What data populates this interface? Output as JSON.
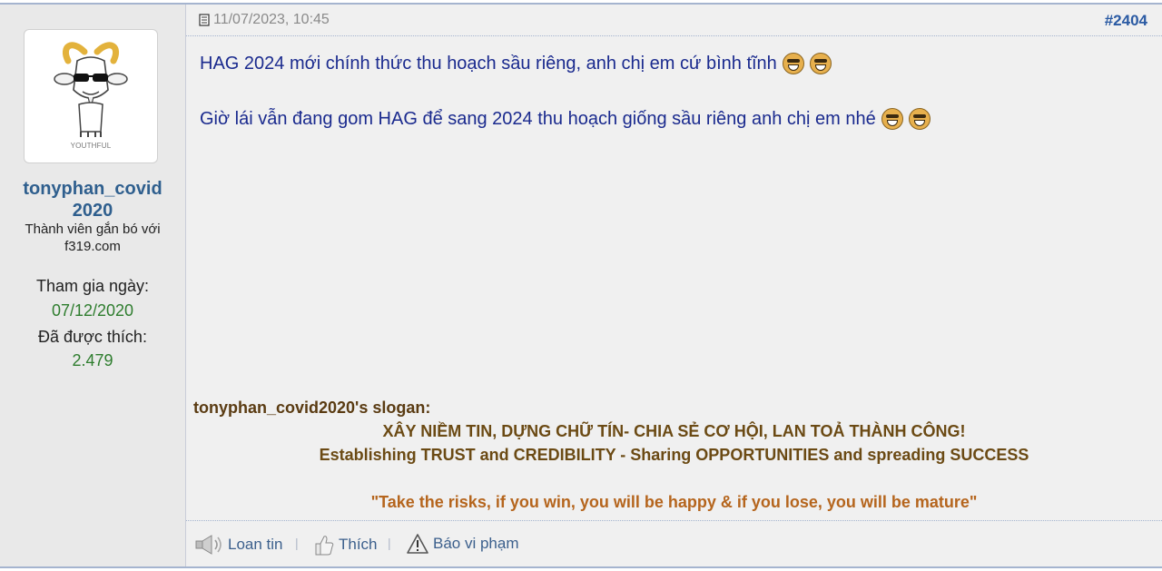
{
  "user": {
    "name": "tonyphan_covid2020",
    "name_line1": "tonyphan_covid",
    "name_line2": "2020",
    "title": "Thành viên gắn bó với f319.com",
    "avatar_caption": "YOUTHFUL",
    "join_label": "Tham gia ngày:",
    "join_date": "07/12/2020",
    "likes_label": "Đã được thích:",
    "likes_count": "2.479"
  },
  "post": {
    "datetime": "11/07/2023, 10:45",
    "number": "#2404",
    "lines": [
      "HAG 2024 mới chính thức thu hoạch sầu riêng, anh chị em cứ bình tĩnh",
      "Giờ lái vẫn đang gom HAG để sang 2024 thu hoạch giống sầu riêng anh chị em nhé"
    ],
    "emoji_name": "laughing-emoji"
  },
  "signature": {
    "label": "tonyphan_covid2020's slogan:",
    "line1": "XÂY NIỀM TIN, DỰNG CHỮ TÍN- CHIA SẺ CƠ HỘI, LAN TOẢ THÀNH CÔNG!",
    "line2": "Establishing TRUST and CREDIBILITY - Sharing OPPORTUNITIES and spreading SUCCESS",
    "quote": "\"Take the risks, if you win, you will be happy & if you lose, you will be mature\"",
    "colors": {
      "label": "#5a3b12",
      "line1": "#6b4a14",
      "line2": "#6b4a14",
      "quote": "#b5651d"
    }
  },
  "actions": {
    "share": {
      "label": "Loan tin",
      "icon": "speaker-icon"
    },
    "like": {
      "label": "Thích",
      "icon": "thumbs-up-icon"
    },
    "report": {
      "label": "Báo vi phạm",
      "icon": "warning-icon"
    }
  },
  "colors": {
    "link": "#2a5aa3",
    "message": "#1a2a8e",
    "stat_value": "#2e7d2e",
    "border": "#a5b4cf"
  }
}
